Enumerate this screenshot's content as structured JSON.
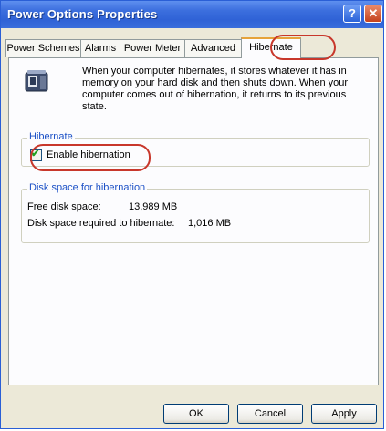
{
  "window": {
    "title": "Power Options Properties",
    "help_glyph": "?",
    "close_glyph": "✕"
  },
  "tabs": [
    {
      "label": "Power Schemes",
      "active": false
    },
    {
      "label": "Alarms",
      "active": false
    },
    {
      "label": "Power Meter",
      "active": false
    },
    {
      "label": "Advanced",
      "active": false
    },
    {
      "label": "Hibernate",
      "active": true
    }
  ],
  "description": "When your computer hibernates, it stores whatever it has in memory on your hard disk and then shuts down. When your computer comes out of hibernation, it returns to its previous state.",
  "hibernate_group": {
    "title": "Hibernate",
    "checkbox_label": "Enable hibernation",
    "checked": true
  },
  "disk_group": {
    "title": "Disk space for hibernation",
    "free_label": "Free disk space:",
    "free_value": "13,989 MB",
    "required_label": "Disk space required to hibernate:",
    "required_value": "1,016 MB"
  },
  "buttons": {
    "ok": "OK",
    "cancel": "Cancel",
    "apply": "Apply"
  },
  "colors": {
    "title_bar": "#2f62d6",
    "highlight_circle": "#c8372b",
    "group_title": "#1b50c6"
  },
  "icons": {
    "hibernate": "hibernate-computer-icon"
  }
}
